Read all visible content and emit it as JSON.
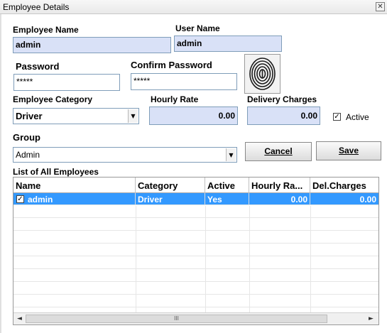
{
  "window": {
    "title": "Employee Details",
    "close_glyph": "✕"
  },
  "form": {
    "employee_name_label": "Employee Name",
    "employee_name_value": "admin",
    "user_name_label": "User Name",
    "user_name_value": "admin",
    "password_label": "Password",
    "password_value": "*****",
    "confirm_password_label": "Confirm Password",
    "confirm_password_value": "*****",
    "fingerprint_icon": "fingerprint-icon",
    "employee_category_label": "Employee Category",
    "employee_category_value": "Driver",
    "hourly_rate_label": "Hourly Rate",
    "hourly_rate_value": "0.00",
    "delivery_charges_label": "Delivery Charges",
    "delivery_charges_value": "0.00",
    "active_label": "Active",
    "active_checked": "✓",
    "group_label": "Group",
    "group_value": "Admin",
    "dropdown_arrow": "▼"
  },
  "buttons": {
    "cancel": "Cancel",
    "save": "Save"
  },
  "list": {
    "title": "List of All Employees",
    "columns": [
      "Name",
      "Category",
      "Active",
      "Hourly Ra...",
      "Del.Charges"
    ],
    "rows": [
      {
        "checked": "✓",
        "name": "admin",
        "category": "Driver",
        "active": "Yes",
        "hourly_rate": "0.00",
        "del_charges": "0.00"
      }
    ],
    "scroll_left": "◄",
    "scroll_right": "►",
    "scroll_grip": "III"
  },
  "colors": {
    "selection": "#3399ff",
    "readonly_field": "#d9e1f7",
    "field_border": "#7f9db9"
  }
}
